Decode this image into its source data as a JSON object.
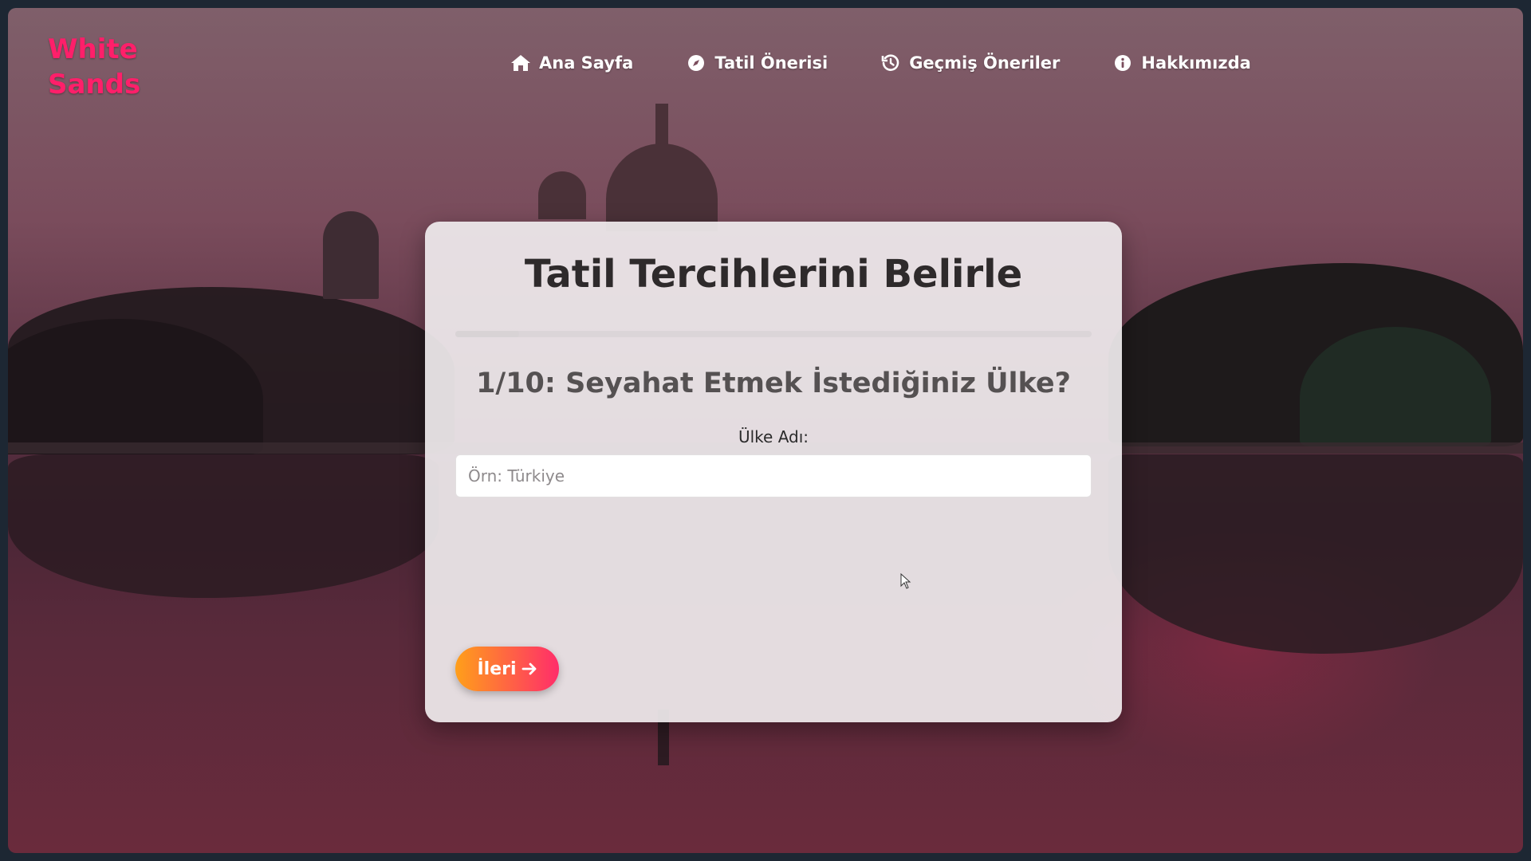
{
  "brand": {
    "line1": "White",
    "line2": "Sands",
    "color": "#ff1f6a"
  },
  "nav": {
    "items": [
      {
        "label": "Ana Sayfa",
        "icon": "home-icon"
      },
      {
        "label": "Tatil Önerisi",
        "icon": "compass-icon"
      },
      {
        "label": "Geçmiş Öneriler",
        "icon": "history-icon"
      },
      {
        "label": "Hakkımızda",
        "icon": "info-icon"
      }
    ]
  },
  "form": {
    "title": "Tatil Tercihlerini Belirle",
    "question": "1/10: Seyahat Etmek İstediğiniz Ülke?",
    "field_label": "Ülke Adı:",
    "input_value": "",
    "input_placeholder": "Örn: Türkiye",
    "next_label": "İleri",
    "next_icon": "arrow-right-icon",
    "progress_fraction": 0.1,
    "button_gradient": [
      "#ff9f1a",
      "#ff2d6a"
    ]
  }
}
